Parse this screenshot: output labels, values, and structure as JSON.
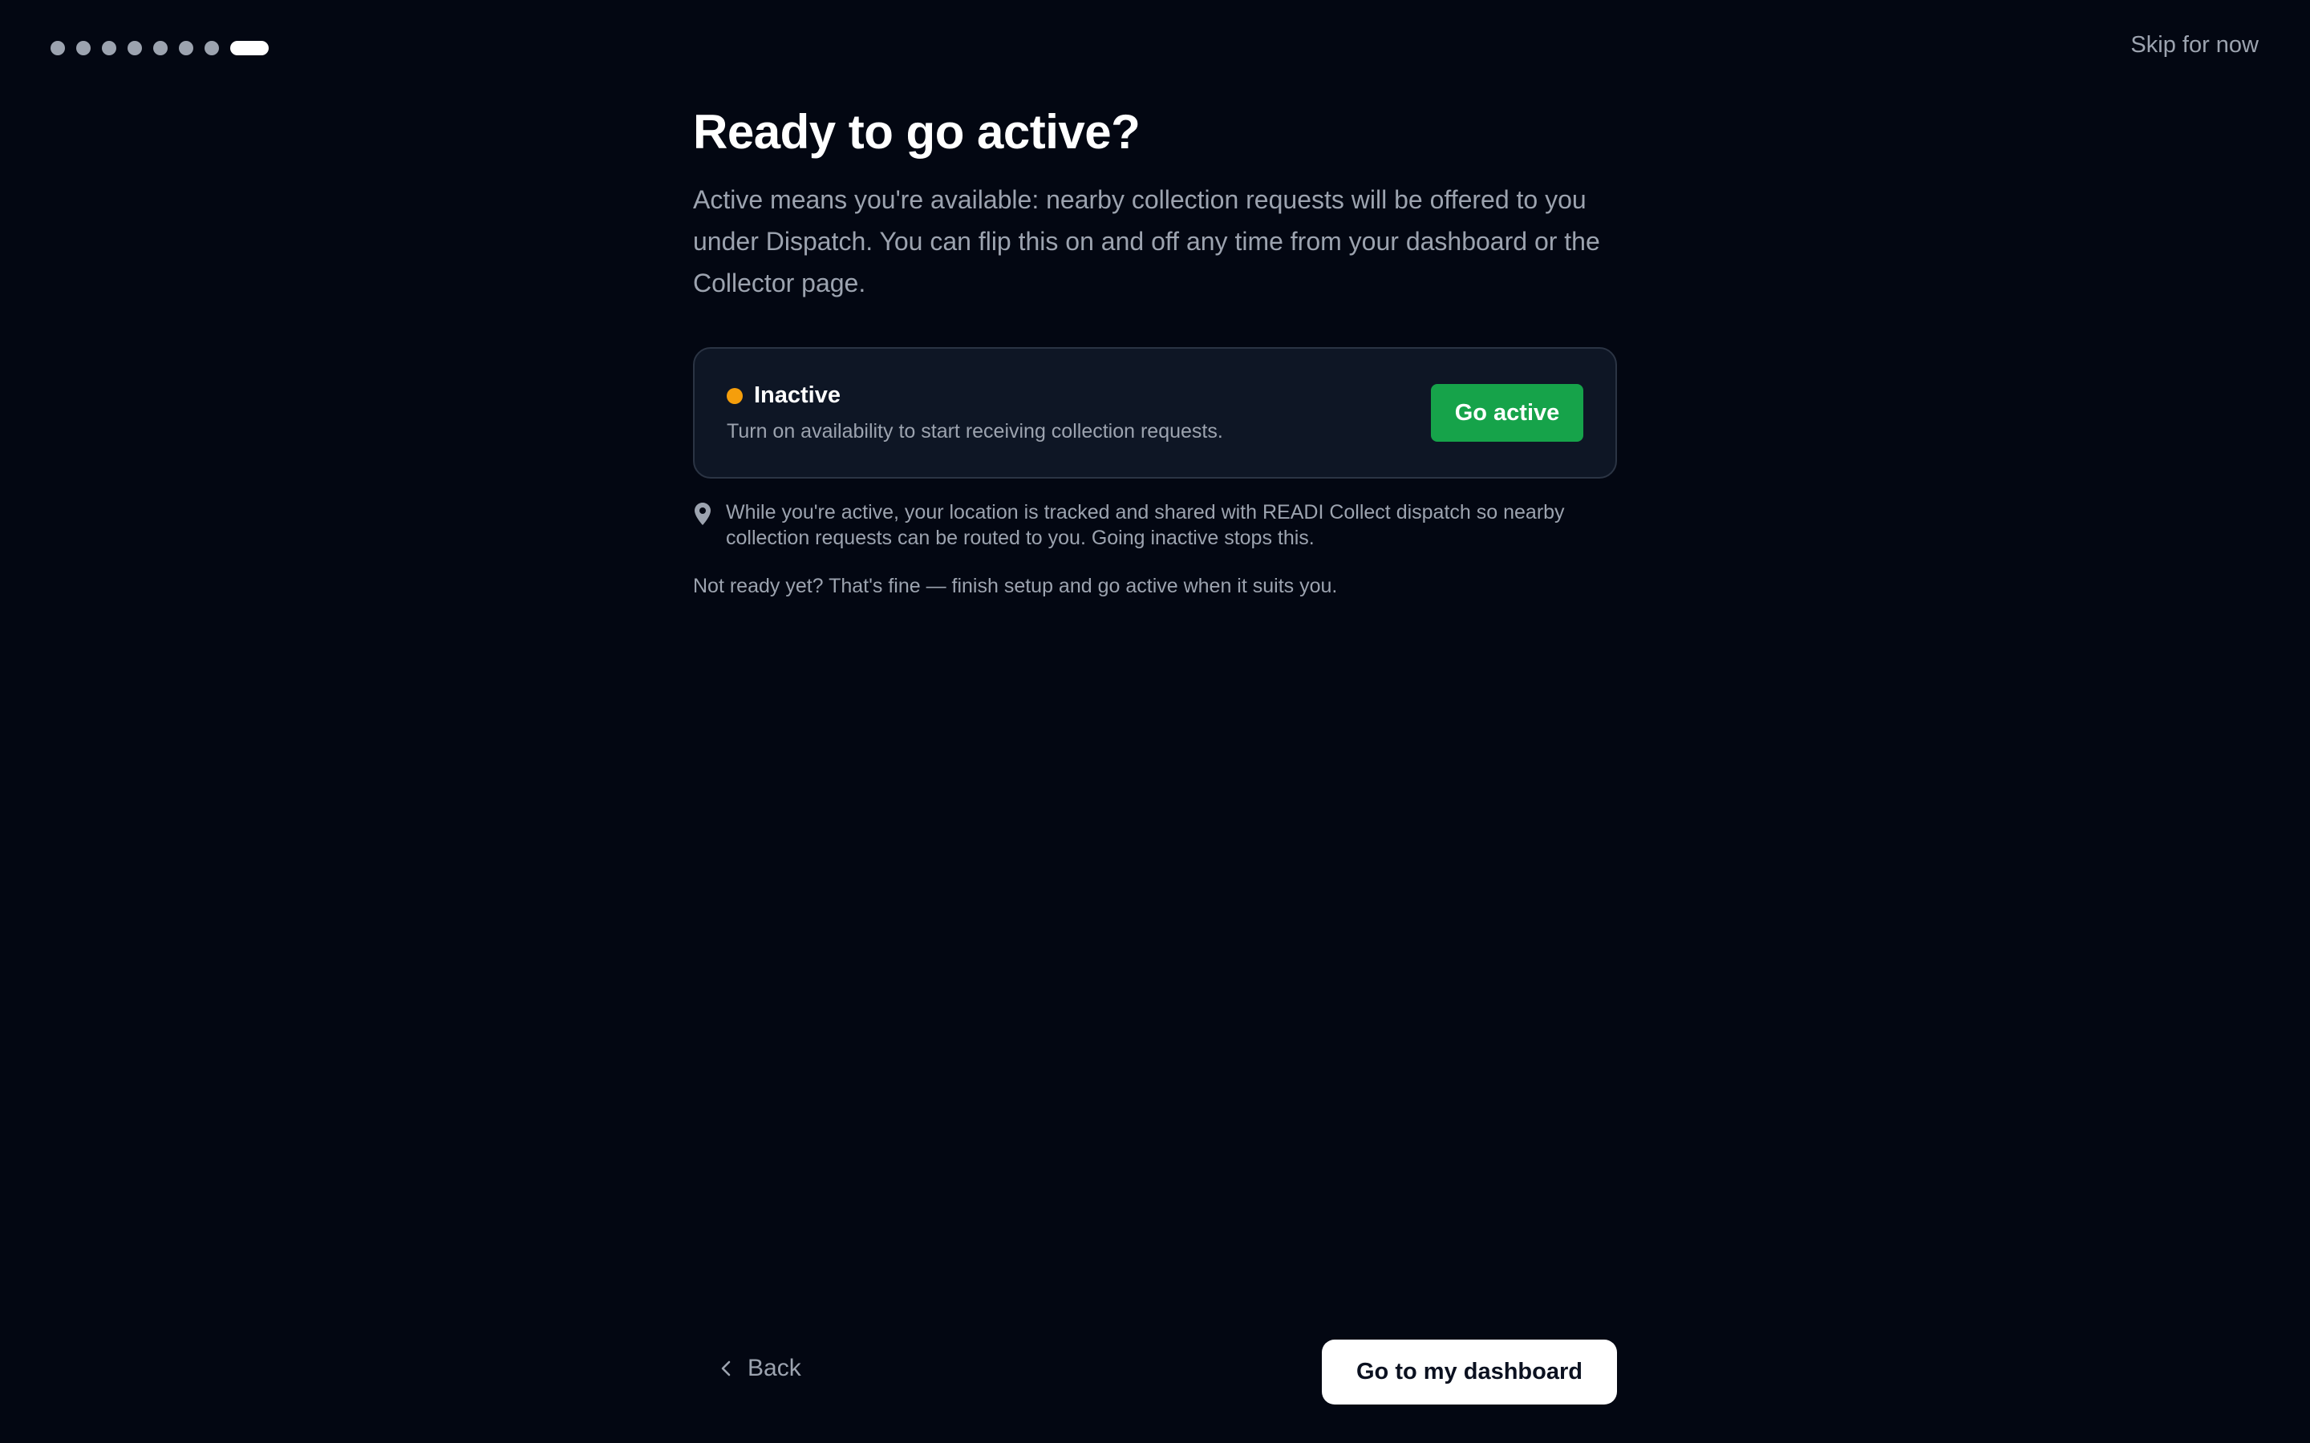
{
  "progress": {
    "total_steps": 8,
    "current_step": 8
  },
  "header": {
    "skip_label": "Skip for now"
  },
  "main": {
    "title": "Ready to go active?",
    "intro": "Active means you're available: nearby collection requests will be offered to you under Dispatch. You can flip this on and off any time from your dashboard or the Collector page."
  },
  "status_card": {
    "status_label": "Inactive",
    "status_color": "#f59e0b",
    "description": "Turn on availability to start receiving collection requests.",
    "button_label": "Go active",
    "button_color": "#16a34a"
  },
  "location_note": {
    "icon": "map-pin-icon",
    "text": "While you're active, your location is tracked and shared with READI Collect dispatch so nearby collection requests can be routed to you. Going inactive stops this."
  },
  "not_ready_text": "Not ready yet? That's fine — finish setup and go active when it suits you.",
  "footer": {
    "back_icon": "chevron-left-icon",
    "back_label": "Back",
    "dashboard_label": "Go to my dashboard"
  }
}
